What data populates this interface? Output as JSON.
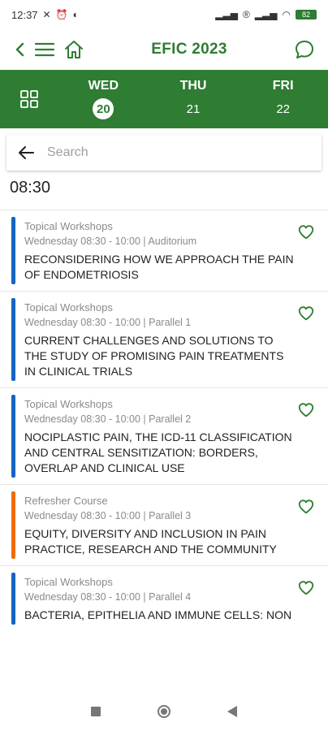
{
  "status_bar": {
    "time": "12:37",
    "left_icons": [
      "sync-off-icon",
      "alarm-icon",
      "circle-status-icon"
    ],
    "right_icons": [
      "cell-signal-icon",
      "data-icon",
      "cell-signal-icon",
      "wifi-icon",
      "battery-icon"
    ],
    "battery": "82"
  },
  "app_bar": {
    "title": "EFIC 2023",
    "icons": [
      "back-chevron-icon",
      "menu-icon",
      "home-icon",
      "chat-icon"
    ]
  },
  "date_tabs": [
    {
      "day": "WED",
      "date": "20",
      "active": true
    },
    {
      "day": "THU",
      "date": "21",
      "active": false
    },
    {
      "day": "FRI",
      "date": "22",
      "active": false
    }
  ],
  "search": {
    "placeholder": "Search"
  },
  "time_header": "08:30",
  "sessions": [
    {
      "category": "Topical Workshops",
      "meta": "Wednesday 08:30 - 10:00 | Auditorium",
      "title": "RECONSIDERING HOW WE APPROACH THE PAIN OF ENDOMETRIOSIS",
      "color": "#1565c0"
    },
    {
      "category": "Topical Workshops",
      "meta": "Wednesday 08:30 - 10:00 | Parallel 1",
      "title": "CURRENT CHALLENGES AND SOLUTIONS TO THE STUDY OF PROMISING PAIN TREATMENTS IN CLINICAL TRIALS",
      "color": "#1565c0"
    },
    {
      "category": "Topical Workshops",
      "meta": "Wednesday 08:30 - 10:00 | Parallel 2",
      "title": "NOCIPLASTIC PAIN, THE ICD-11 CLASSIFICATION AND CENTRAL SENSITIZATION: BORDERS, OVERLAP AND CLINICAL USE",
      "color": "#1565c0"
    },
    {
      "category": "Refresher Course",
      "meta": "Wednesday 08:30 - 10:00 | Parallel 3",
      "title": "EQUITY, DIVERSITY AND INCLUSION IN PAIN PRACTICE, RESEARCH AND THE COMMUNITY",
      "color": "#ef6c00"
    },
    {
      "category": "Topical Workshops",
      "meta": "Wednesday 08:30 - 10:00 | Parallel 4",
      "title": "BACTERIA, EPITHELIA AND IMMUNE CELLS: NON",
      "color": "#1565c0"
    }
  ],
  "nav_bar": [
    "recents-square-icon",
    "home-circle-icon",
    "back-triangle-icon"
  ],
  "colors": {
    "brand_green": "#2e7d32",
    "workshop_blue": "#1565c0",
    "refresher_orange": "#ef6c00"
  }
}
